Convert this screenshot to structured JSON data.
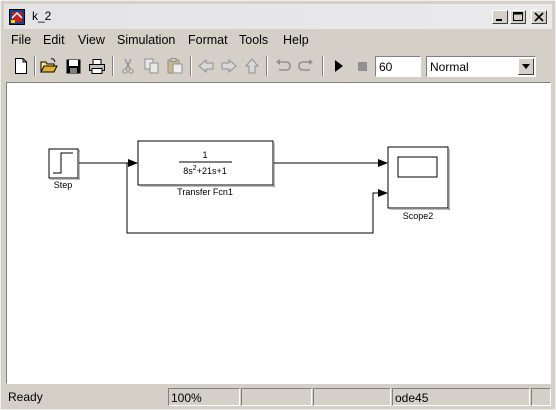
{
  "window": {
    "title": "k_2"
  },
  "menu": [
    "File",
    "Edit",
    "View",
    "Simulation",
    "Format",
    "Tools",
    "Help"
  ],
  "toolbar": {
    "stop_time": "60",
    "sim_mode": "Normal",
    "icons": [
      "new-icon",
      "open-icon",
      "save-icon",
      "print-icon",
      "cut-icon",
      "copy-icon",
      "paste-icon",
      "back-icon",
      "forward-icon",
      "up-icon",
      "undo-icon",
      "redo-icon",
      "play-icon",
      "stop-icon"
    ]
  },
  "diagram": {
    "blocks": {
      "step": {
        "label": "Step"
      },
      "transfer_fcn": {
        "label": "Transfer Fcn1",
        "numerator": "1",
        "denominator_a": "8s",
        "denominator_exp": "2",
        "denominator_b": "+21s+1"
      },
      "scope": {
        "label": "Scope2"
      }
    }
  },
  "status": {
    "state": "Ready",
    "zoom": "100%",
    "solver": "ode45"
  }
}
